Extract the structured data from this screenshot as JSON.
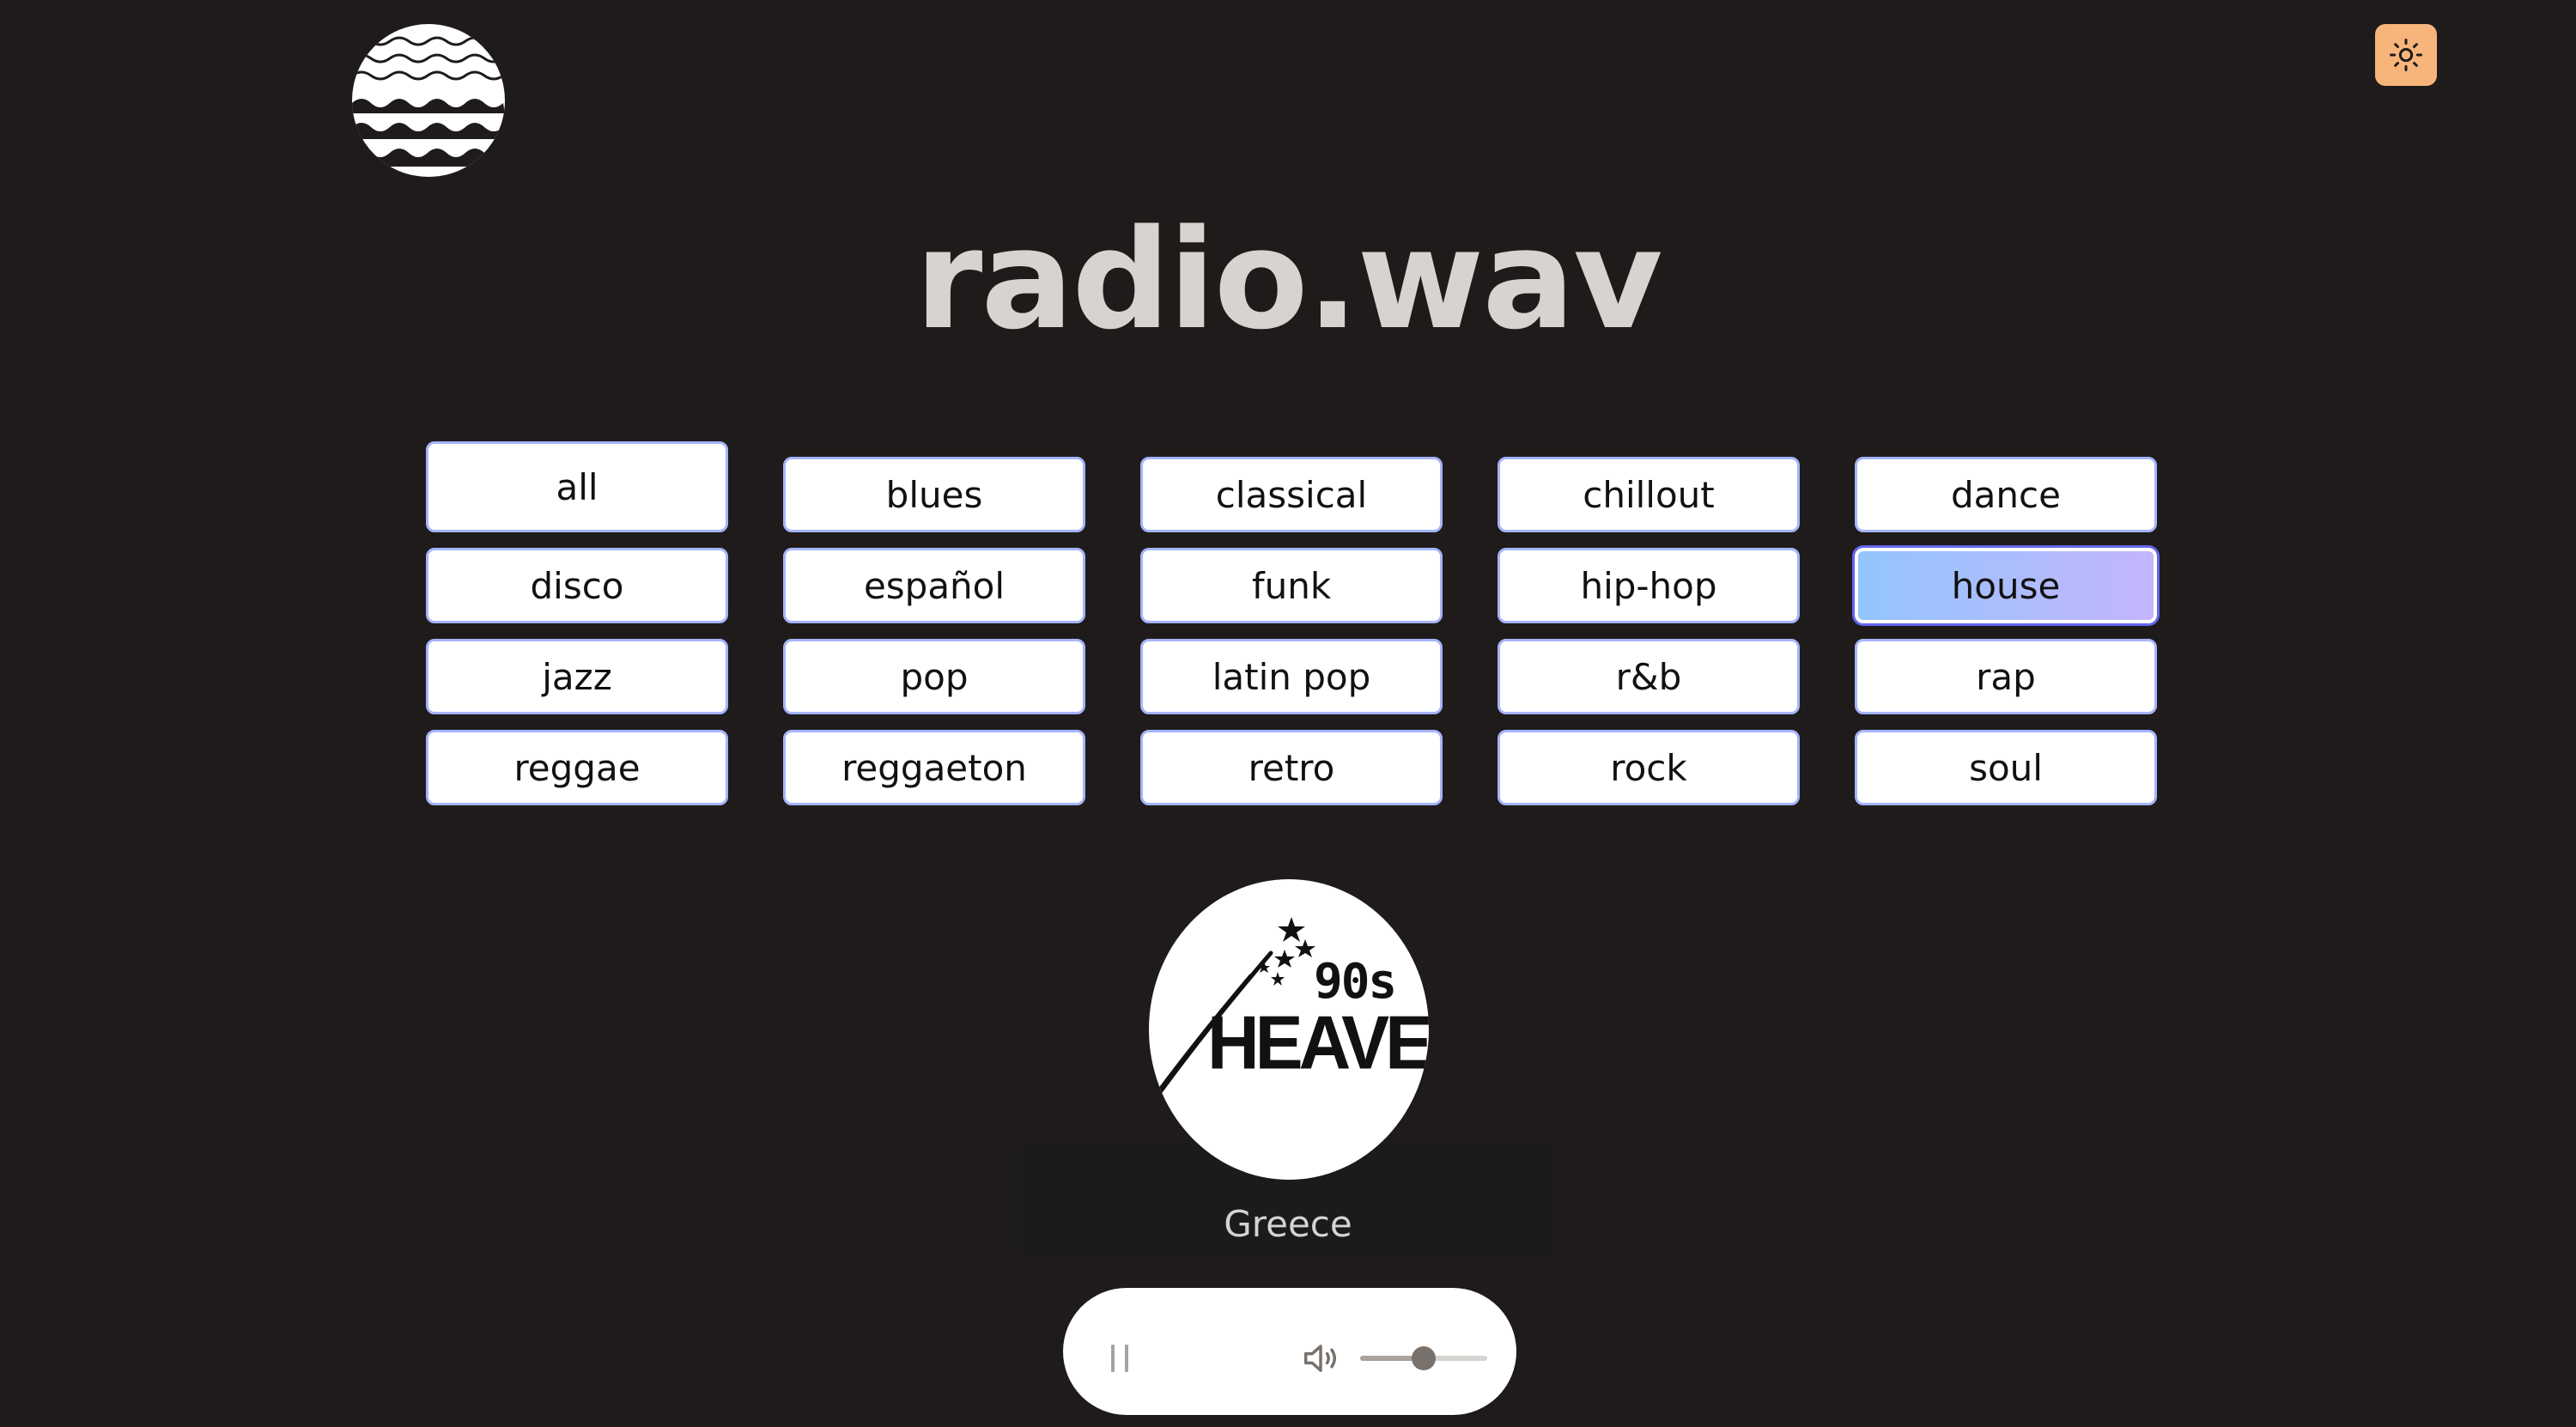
{
  "app": {
    "title": "radio.wav",
    "logo_icon": "waves-logo-icon",
    "theme_toggle_icon": "sun-icon",
    "theme_toggle_color": "#f7b57b"
  },
  "genres": [
    {
      "label": "all",
      "selected": false
    },
    {
      "label": "blues",
      "selected": false
    },
    {
      "label": "classical",
      "selected": false
    },
    {
      "label": "chillout",
      "selected": false
    },
    {
      "label": "dance",
      "selected": false
    },
    {
      "label": "disco",
      "selected": false
    },
    {
      "label": "español",
      "selected": false
    },
    {
      "label": "funk",
      "selected": false
    },
    {
      "label": "hip-hop",
      "selected": false
    },
    {
      "label": "house",
      "selected": true
    },
    {
      "label": "jazz",
      "selected": false
    },
    {
      "label": "pop",
      "selected": false
    },
    {
      "label": "latin pop",
      "selected": false
    },
    {
      "label": "r&b",
      "selected": false
    },
    {
      "label": "rap",
      "selected": false
    },
    {
      "label": "reggae",
      "selected": false
    },
    {
      "label": "reggaeton",
      "selected": false
    },
    {
      "label": "retro",
      "selected": false
    },
    {
      "label": "rock",
      "selected": false
    },
    {
      "label": "soul",
      "selected": false
    }
  ],
  "station": {
    "logo_line1": "90s",
    "logo_line2": "HEAVEN",
    "country": "Greece"
  },
  "player": {
    "pause_icon": "pause-icon",
    "volume_icon": "volume-icon",
    "volume_level": 0.5
  },
  "colors": {
    "background": "#1f1b1b",
    "title": "#d6d3d1",
    "selected_gradient": [
      "#93c5fd",
      "#c4b5fd"
    ],
    "button_border": "#a5b4fc"
  }
}
